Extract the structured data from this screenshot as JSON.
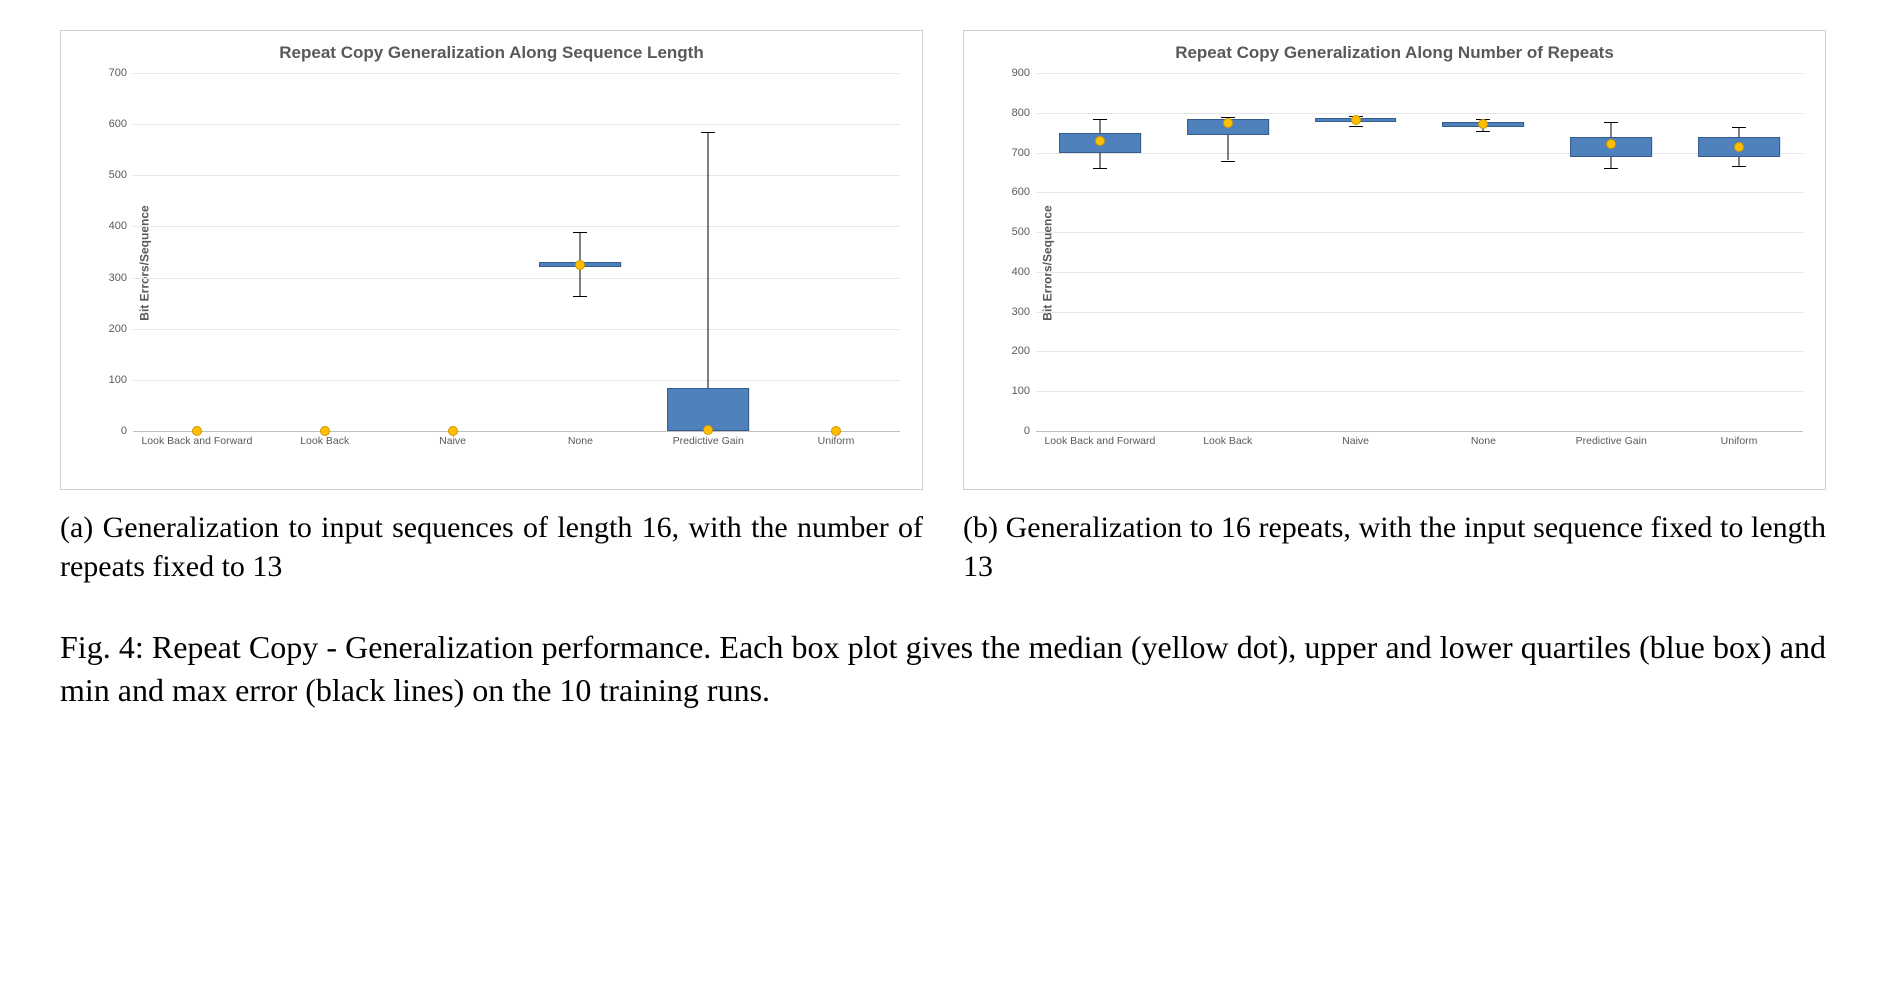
{
  "chart_data": [
    {
      "id": "chart-a",
      "type": "boxplot",
      "title": "Repeat Copy Generalization Along Sequence Length",
      "ylabel": "Bit Errors/Sequence",
      "ylim": [
        0,
        700
      ],
      "ystep": 100,
      "categories": [
        "Look Back and Forward",
        "Look Back",
        "Naive",
        "None",
        "Predictive Gain",
        "Uniform"
      ],
      "series": [
        {
          "median": 0,
          "q1": 0,
          "q3": 0,
          "min": 0,
          "max": 0
        },
        {
          "median": 0,
          "q1": 0,
          "q3": 0,
          "min": 0,
          "max": 0
        },
        {
          "median": 0,
          "q1": 0,
          "q3": 0,
          "min": 0,
          "max": 0
        },
        {
          "median": 325,
          "q1": 320,
          "q3": 330,
          "min": 263,
          "max": 390
        },
        {
          "median": 2,
          "q1": 0,
          "q3": 85,
          "min": 0,
          "max": 585
        },
        {
          "median": 0,
          "q1": 0,
          "q3": 0,
          "min": 0,
          "max": 0
        }
      ]
    },
    {
      "id": "chart-b",
      "type": "boxplot",
      "title": "Repeat Copy Generalization Along Number of Repeats",
      "ylabel": "Bit Errors/Sequence",
      "ylim": [
        0,
        900
      ],
      "ystep": 100,
      "categories": [
        "Look Back and Forward",
        "Look Back",
        "Naive",
        "None",
        "Predictive Gain",
        "Uniform"
      ],
      "series": [
        {
          "median": 730,
          "q1": 700,
          "q3": 750,
          "min": 660,
          "max": 785
        },
        {
          "median": 775,
          "q1": 745,
          "q3": 785,
          "min": 680,
          "max": 790
        },
        {
          "median": 782,
          "q1": 778,
          "q3": 788,
          "min": 768,
          "max": 792
        },
        {
          "median": 772,
          "q1": 765,
          "q3": 778,
          "min": 755,
          "max": 785
        },
        {
          "median": 722,
          "q1": 690,
          "q3": 740,
          "min": 660,
          "max": 778
        },
        {
          "median": 715,
          "q1": 690,
          "q3": 740,
          "min": 665,
          "max": 765
        }
      ]
    }
  ],
  "subcaptions": {
    "a": "(a) Generalization to input sequences of length 16, with the number of repeats fixed to 13",
    "b": "(b) Generalization to 16 repeats, with the input sequence fixed to length 13"
  },
  "figcaption": "Fig. 4: Repeat Copy - Generalization performance. Each box plot gives the median (yellow dot), upper and lower quartiles (blue box) and min and max error (black lines) on the 10 training runs."
}
